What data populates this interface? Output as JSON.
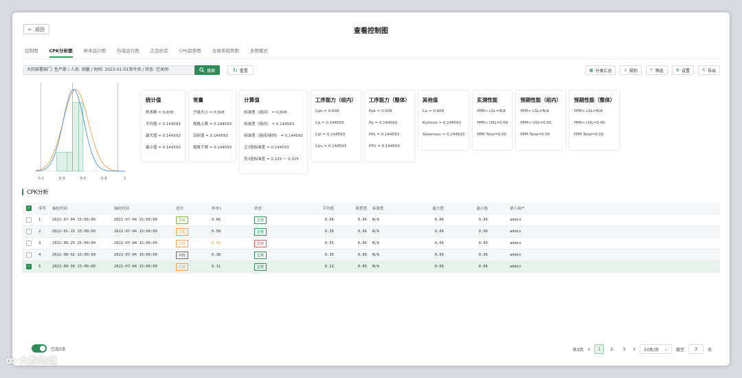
{
  "header": {
    "back_label": "返回",
    "title": "查看控制图"
  },
  "tabs": [
    "控制图",
    "CPK分析图",
    "样本运行图",
    "均值运行图",
    "正态检验",
    "CPK趋势图",
    "合格率趋势图",
    "多图模式"
  ],
  "active_tab": 1,
  "filter": {
    "text": "大的部署部门: 生产部 / 人员: 测量 / 时间: 2023-01-01到今天 / 状态: 已关闭",
    "query_label": "搜索",
    "reset_label": "重置"
  },
  "toolbar": [
    {
      "label": "分类汇总",
      "icon": "grid-icon"
    },
    {
      "label": "规则",
      "icon": "magnet-icon"
    },
    {
      "label": "筛选",
      "icon": "filter-icon"
    },
    {
      "label": "设置",
      "icon": "gear-icon"
    },
    {
      "label": "导出",
      "icon": "export-icon"
    }
  ],
  "histogram": {
    "x_ticks": [
      "0.2",
      "0.4",
      "0.6",
      "0.8",
      "1"
    ],
    "bins": [
      {
        "from": 0.35,
        "to": 0.45,
        "height": 0.22
      },
      {
        "from": 0.45,
        "to": 0.5,
        "height": 0.22
      },
      {
        "from": 0.5,
        "to": 0.56,
        "height": 0.8
      },
      {
        "from": 0.56,
        "to": 0.6,
        "height": 0.8
      }
    ],
    "lines": {
      "lsl": 0.2,
      "center": 0.5,
      "usl": 0.93
    },
    "colors": {
      "orange": "#f0a04b",
      "blue": "#4a90d9",
      "green": "#6fbf9a"
    }
  },
  "cards": [
    {
      "title": "统计值",
      "lines": [
        "样本数 = 0.608",
        "平均值 = 0.144593",
        "最大值 = 0.144593",
        "最小值 = 0.144593"
      ]
    },
    {
      "title": "常量",
      "lines": [
        "子组大小 = 0.608",
        "规格上限 = 0.144593",
        "目标值 = 0.144593",
        "规格下限 = 0.144593"
      ]
    },
    {
      "title": "计算值",
      "lines": [
        "标准差（组间） = 0.608",
        "标准差（组内） = 0.144593",
        "标准差（组间/组内） = 0.144593",
        "正3倍标准差 = 0.144593",
        "负3倍标准差 = 0.225 ～ 0.225"
      ]
    },
    {
      "title": "工序能力（组内）",
      "lines": [
        "Cpk = 0.608",
        "Cp = 0.144593",
        "Cpl = 0.144593",
        "Cpu = 0.144593"
      ]
    },
    {
      "title": "工序能力（整体）",
      "lines": [
        "Ppk = 0.608",
        "Pp = 0.144593",
        "PPL = 0.144593",
        "PPU = 0.144593"
      ]
    },
    {
      "title": "其他值",
      "lines": [
        "Ca = 0.608",
        "Kurtosis = 0.144593",
        "Skewness = 0.144593"
      ]
    },
    {
      "title": "实测性能",
      "lines": [
        "PPM< LSL=N/A",
        "PPM< USL=0.00",
        "PPM Total=0.00"
      ]
    },
    {
      "title": "预期性能（组内）",
      "lines": [
        "PPM< LSL=N/A",
        "PPM< USL=0.00",
        "PPM Total=0.00"
      ]
    },
    {
      "title": "预期性能（整体）",
      "lines": [
        "PPM< LSL=N/A",
        "PPM< USL=0.00",
        "PPM Total=0.00"
      ]
    }
  ],
  "section_title": "CPK分析",
  "table": {
    "headers": [
      "序号",
      "抽检时间",
      "抽检时间",
      "班次",
      "样本1",
      "状态",
      "平均值",
      "极差值",
      "标准差",
      "最大值",
      "最小值",
      "录入用户"
    ],
    "rows": [
      {
        "idx": "1",
        "t1": "2022-07-04 15:00:00",
        "t2": "2022-07-04 15:00:00",
        "shift": "早班",
        "shift_color": "#7cb342",
        "s1": "0.66",
        "s1_color": "#333333",
        "state": "正常",
        "state_color": "#2e8b57",
        "avg": "0.66",
        "range": "0.66",
        "std": "N/A",
        "max": "0.66",
        "min": "0.66",
        "user": "admin",
        "checked": false
      },
      {
        "idx": "2",
        "t1": "2022-01-15 15:00:00",
        "t2": "2022-07-04 15:00:00",
        "shift": "乙班",
        "shift_color": "#f0a04b",
        "s1": "0.58",
        "s1_color": "#333333",
        "state": "正常",
        "state_color": "#2e8b57",
        "avg": "0.58",
        "range": "0.66",
        "std": "N/A",
        "max": "0.66",
        "min": "0.66",
        "user": "admin",
        "checked": false
      },
      {
        "idx": "3",
        "t1": "2022-08-25 15:00:00",
        "t2": "2022-07-04 15:00:00",
        "shift": "乙班",
        "shift_color": "#f0a04b",
        "s1": "0.66",
        "s1_color": "#f0a04b",
        "state": "异常",
        "state_color": "#e05a5a",
        "avg": "0.55",
        "range": "0.66",
        "std": "N/A",
        "max": "0.66",
        "min": "0.66",
        "user": "admin",
        "checked": false
      },
      {
        "idx": "4",
        "t1": "2022-08-02 15:00:00",
        "t2": "2022-07-04 15:00:00",
        "shift": "丙班",
        "shift_color": "#666666",
        "s1": "0.38",
        "s1_color": "#333333",
        "state": "正常",
        "state_color": "#2e8b57",
        "avg": "0.35",
        "range": "0.66",
        "std": "N/A",
        "max": "0.66",
        "min": "0.66",
        "user": "admin",
        "checked": false
      },
      {
        "idx": "5",
        "t1": "2022-08-30 15:00:00",
        "t2": "2022-07-04 15:00:00",
        "shift": "乙班",
        "shift_color": "#f0a04b",
        "s1": "0.11",
        "s1_color": "#333333",
        "state": "正常",
        "state_color": "#2e8b57",
        "avg": "0.22",
        "range": "0.66",
        "std": "N/A",
        "max": "0.66",
        "min": "0.66",
        "user": "admin",
        "checked": true
      }
    ]
  },
  "footer": {
    "toggle_label": "已选5条",
    "total": "共3页",
    "pages": [
      "1",
      "2",
      "3"
    ],
    "active_page": "1",
    "page_size": "50条/页",
    "goto_label": "跳至",
    "goto_value": "3",
    "goto_suffix": "页"
  },
  "watermark": "大数跨境"
}
